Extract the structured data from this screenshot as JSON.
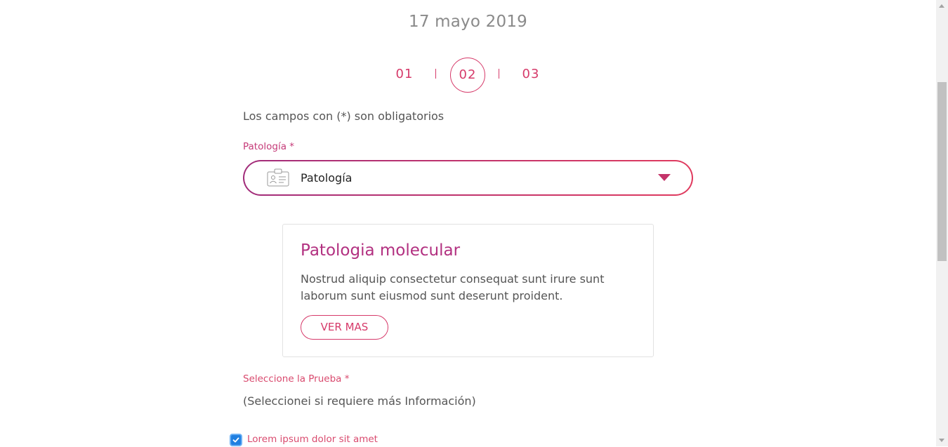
{
  "header": {
    "date": "17 mayo 2019"
  },
  "stepper": {
    "steps": [
      {
        "label": "01",
        "active": false
      },
      {
        "label": "02",
        "active": true
      },
      {
        "label": "03",
        "active": false
      }
    ]
  },
  "form": {
    "required_note": "Los campos con (*) son obligatorios",
    "pathology": {
      "label": "Patología *",
      "value": "Patología",
      "icon": "id-card-icon",
      "caret_icon": "caret-down-icon"
    },
    "info_card": {
      "title": "Patologia molecular",
      "text": "Nostrud aliquip consectetur consequat sunt irure sunt laborum sunt eiusmod sunt deserunt proident.",
      "button_label": "VER MAS"
    },
    "test": {
      "label": "Seleccione la Prueba *",
      "hint": "(Seleccionei si requiere más Información)"
    },
    "option": {
      "checked": true,
      "label": "Lorem ipsum dolor sit amet"
    }
  },
  "colors": {
    "accent": "#d63a6a",
    "gradient_start": "#a12c7a",
    "gradient_end": "#e03a5e",
    "title": "#b23080",
    "checkbox": "#1f7fe0"
  }
}
